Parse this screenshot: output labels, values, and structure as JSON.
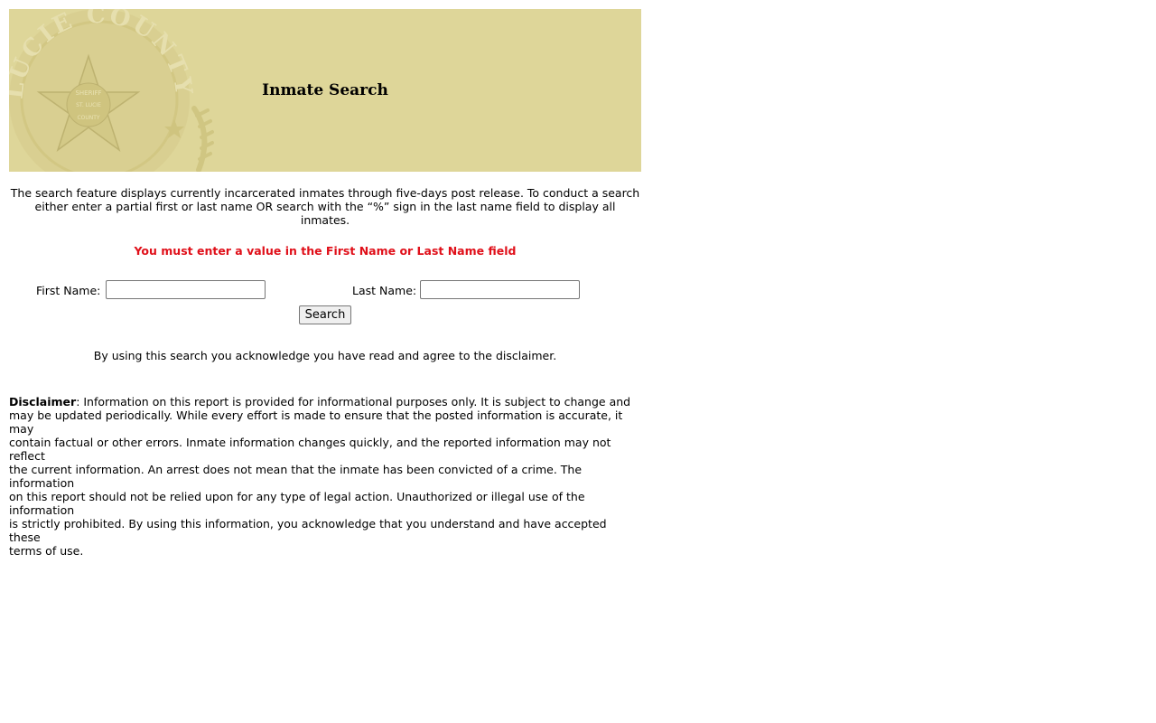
{
  "header": {
    "title": "Inmate Search",
    "seal_text": "LUCIE COUNTY",
    "seal_inner_top": "SHERIFF",
    "seal_inner_mid": "ST. LUCIE",
    "seal_inner_bottom": "COUNTY"
  },
  "intro": {
    "line1": "The search feature displays currently incarcerated inmates through five-days post release. To conduct a search",
    "line2": "either enter a partial first or last name OR search with the “%” sign in the last name field to display all inmates."
  },
  "error_message": "You must enter a value in the First Name or Last Name field",
  "form": {
    "first_name_label": "First Name:",
    "first_name_value": "",
    "last_name_label": "Last Name:",
    "last_name_value": "",
    "search_button": "Search"
  },
  "acknowledgement": "By using this search you acknowledge you have read and agree to the disclaimer.",
  "disclaimer": {
    "heading": "Disclaimer",
    "lines": [
      ": Information on this report is provided for informational purposes only.  It is subject to change and",
      "may be updated periodically.  While every effort is made to ensure that the posted information is accurate, it may",
      "contain factual or other errors.  Inmate information changes quickly, and the reported information may not reflect",
      "the current information.  An arrest does not mean that the inmate has been convicted of a crime.  The information",
      "on this report should not be relied upon for any type of legal action.  Unauthorized or illegal use of the information",
      "is strictly prohibited.  By using this information, you acknowledge that you understand and have accepted these",
      "terms of use."
    ]
  },
  "colors": {
    "banner_bg": "#ded699",
    "seal_tint": "#cdc283",
    "error_red": "#e0101a"
  }
}
